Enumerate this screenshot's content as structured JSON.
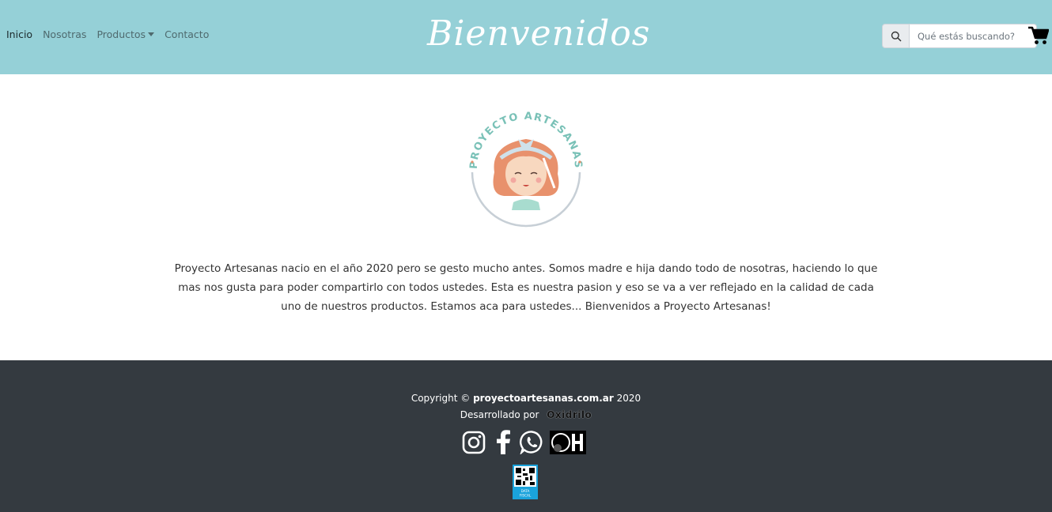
{
  "nav": {
    "items": [
      {
        "label": "Inicio"
      },
      {
        "label": "Nosotras"
      },
      {
        "label": "Productos"
      },
      {
        "label": "Contacto"
      }
    ],
    "brand": "Bienvenidos"
  },
  "search": {
    "placeholder": "Qué estás buscando?"
  },
  "main": {
    "logo_text": "PROYECTO ARTESANAS",
    "about": "Proyecto Artesanas nacio en el año 2020 pero se gesto mucho antes. Somos madre e hija dando todo de nosotras, haciendo lo que mas nos gusta para poder compartirlo con todos ustedes. Esta es nuestra pasion y eso se va a ver reflejado en la calidad de cada uno de nuestros productos. Estamos aca para ustedes... Bienvenidos a Proyecto Artesanas!"
  },
  "footer": {
    "copyright_prefix": "Copyright ©",
    "copyright_site": "proyectoartesanas.com.ar",
    "copyright_year": "2020",
    "dev_label": "Desarrollado por",
    "dev_brand": "Oxidrilo",
    "socials": [
      "instagram-icon",
      "facebook-icon",
      "whatsapp-icon",
      "oxidrilo-icon"
    ],
    "datafiscal_text": "DATA FISCAL"
  },
  "colors": {
    "navbar": "#95d0d7",
    "footer": "#343a40",
    "logo_teal": "#79c1b7",
    "logo_orange": "#e8916c"
  }
}
